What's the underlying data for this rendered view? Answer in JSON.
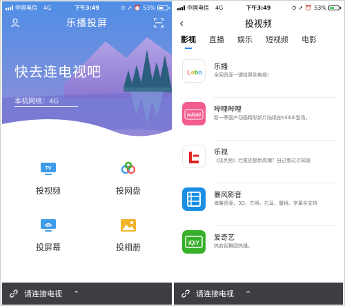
{
  "left": {
    "status": {
      "carrier": "中国电信",
      "network": "4G",
      "time": "下午3:49",
      "battery": "53%"
    },
    "header": {
      "title": "乐播投屏"
    },
    "hero": {
      "title": "快去连电视吧",
      "network_label": "本机网络：4G"
    },
    "tiles": [
      {
        "label": "投视频",
        "icon": "tv-icon",
        "color": "#3d9be9"
      },
      {
        "label": "投网盘",
        "icon": "cloud-icon",
        "color": "#3d9be9"
      },
      {
        "label": "投屏幕",
        "icon": "screen-mirror-icon",
        "color": "#3d9be9"
      },
      {
        "label": "投相册",
        "icon": "photo-icon",
        "color": "#f0b429"
      }
    ],
    "bottom": {
      "label": "请连接电视"
    }
  },
  "right": {
    "status": {
      "carrier": "中国电信",
      "network": "4G",
      "time": "下午3:49",
      "battery": "53%"
    },
    "nav": {
      "title": "投视频",
      "back": "‹"
    },
    "tabs": [
      "影视",
      "直播",
      "娱乐",
      "短视频",
      "电影"
    ],
    "active_tab": "影视",
    "apps": [
      {
        "name": "乐播",
        "desc": "全网资源一键投屏到电视!",
        "logo_text": "Lebo",
        "color": "#ffffff"
      },
      {
        "name": "哔哩哔哩",
        "desc": "新一季国产动画精彩新片陆续在bilibili登场。",
        "logo_text": "bilibili",
        "color": "#f25d8e"
      },
      {
        "name": "乐视",
        "desc": "《谈判官》烂尾还是新高潮？自己看过才知道",
        "logo_text": "L",
        "color": "#ffffff"
      },
      {
        "name": "暴风影音",
        "desc": "海量资源，3D、左眼、右耳、魔镜、字幕全支持",
        "logo_text": "",
        "color": "#1a8fe3"
      },
      {
        "name": "爱奇艺",
        "desc": "热血街舞团热播。",
        "logo_text": "iQIY",
        "color": "#36b029"
      }
    ],
    "bottom": {
      "label": "请连接电视"
    }
  }
}
